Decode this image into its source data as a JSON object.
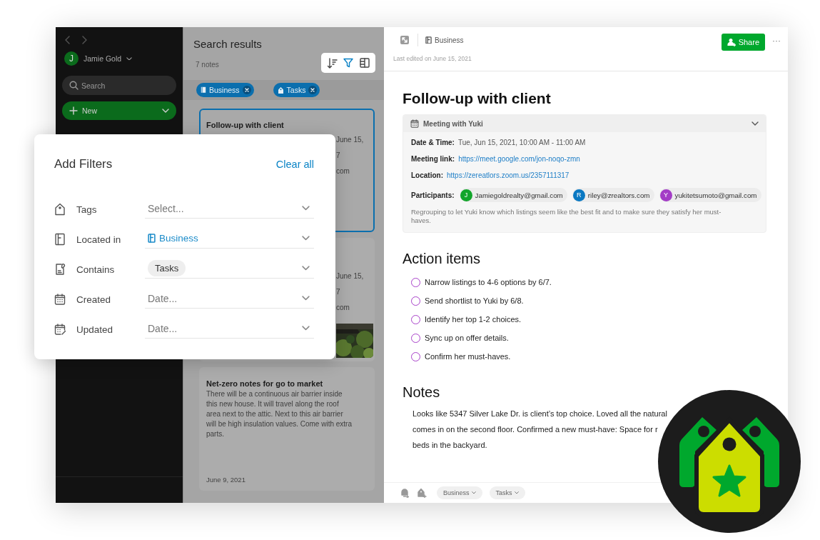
{
  "sidebar": {
    "user": {
      "initial": "J",
      "name": "Jamie Gold"
    },
    "search": {
      "placeholder": "Search"
    },
    "new_button": "New"
  },
  "note_list": {
    "title": "Search results",
    "count": "7 notes",
    "filters": [
      {
        "label": "Business",
        "kind": "notebook"
      },
      {
        "label": "Tasks",
        "kind": "tag"
      }
    ],
    "cards": [
      {
        "kind": "text",
        "selected": true,
        "title": "Follow-up with client",
        "snippets": [
          "June 15,",
          "7",
          "com"
        ]
      },
      {
        "kind": "picture",
        "selected": false,
        "snippets": [
          "June 15,",
          "7",
          "com"
        ]
      },
      {
        "kind": "text",
        "selected": false,
        "title": "Net-zero notes for go to market",
        "body": "There will be a continuous air barrier inside this new house. It will travel along the roof area next to the attic. Next to this air barrier will be high insulation values. Come with extra parts.",
        "date": "June 9, 2021"
      }
    ]
  },
  "filter_popup": {
    "title": "Add Filters",
    "clear": "Clear all",
    "rows": [
      {
        "kind": "tags",
        "label": "Tags",
        "placeholder": "Select..."
      },
      {
        "kind": "notebook",
        "label": "Located in",
        "value": "Business"
      },
      {
        "kind": "contains",
        "label": "Contains",
        "chip": "Tasks"
      },
      {
        "kind": "created",
        "label": "Created",
        "placeholder": "Date..."
      },
      {
        "kind": "updated",
        "label": "Updated",
        "placeholder": "Date..."
      }
    ]
  },
  "note": {
    "notebook": "Business",
    "share": "Share",
    "more": "···",
    "last_edited": "Last edited on June 15, 2021",
    "title": "Follow-up with client",
    "meeting": {
      "title": "Meeting with Yuki",
      "fields": [
        {
          "kind": "text",
          "label": "Date & Time:",
          "value": "Tue, Jun 15, 2021, 10:00 AM - 11:00 AM"
        },
        {
          "kind": "link",
          "label": "Meeting link:",
          "value": "https://meet.google.com/jon-noqo-zmn"
        },
        {
          "kind": "link",
          "label": "Location:",
          "value": "https://zereatlors.zoom.us/2357111317"
        }
      ],
      "participants_label": "Participants:",
      "participants": [
        {
          "initial": "J",
          "email": "Jamiegoldrealty@gmail.com",
          "color": "#12a52a"
        },
        {
          "initial": "R",
          "email": "riley@zrealtors.com",
          "color": "#0a78c2"
        },
        {
          "initial": "Y",
          "email": "yukitetsumoto@gmail.com",
          "color": "#a33cc6"
        }
      ],
      "description": "Regrouping to let Yuki know which listings seem like the best fit and to make sure they satisfy her must-haves."
    },
    "action_heading": "Action items",
    "action_items": [
      {
        "text": "Narrow listings to 4-6 options by 6/7.",
        "checked": false
      },
      {
        "text": "Send shortlist to Yuki by 6/8.",
        "checked": false
      },
      {
        "text": "Identify her top 1-2 choices.",
        "checked": false
      },
      {
        "text": "Sync up on offer details.",
        "checked": false
      },
      {
        "text": "Confirm her must-haves.",
        "checked": false
      }
    ],
    "notes_heading": "Notes",
    "notes_text": "Looks like 5347 Silver Lake Dr. is client’s top choice. Loved all the natural\ncomes in on the second floor. Confirmed a new must-have: Space for r\nbeds in the backyard.",
    "tags": [
      "Business",
      "Tasks"
    ]
  }
}
